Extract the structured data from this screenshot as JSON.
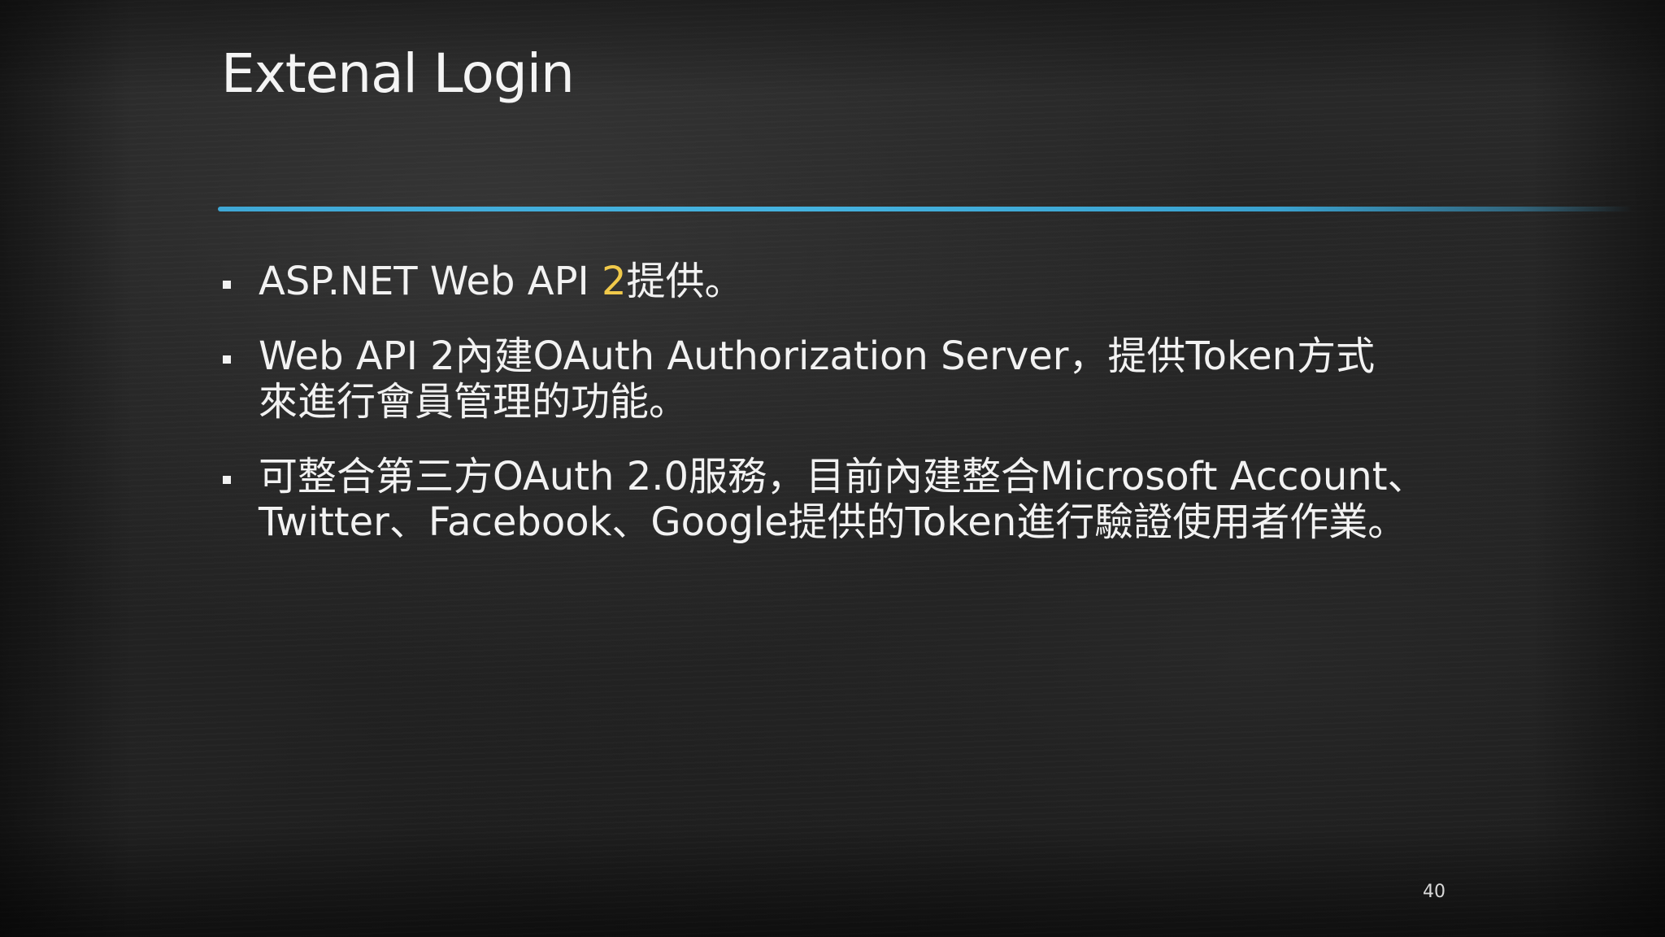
{
  "slide": {
    "title": "Extenal Login",
    "accent_color": "#f0c94a",
    "rule_color": "#3fa8d6",
    "bullets": [
      {
        "lines": [
          {
            "before": "ASP.NET Web API ",
            "accent": "2",
            "after": "提供。"
          }
        ]
      },
      {
        "lines": [
          "Web API 2內建OAuth Authorization Server，提供Token方式",
          "來進行會員管理的功能。"
        ]
      },
      {
        "lines": [
          "可整合第三方OAuth 2.0服務，目前內建整合Microsoft Account、",
          "Twitter、Facebook、Google提供的Token進行驗證使用者作業。"
        ]
      }
    ],
    "page_number": "40"
  }
}
